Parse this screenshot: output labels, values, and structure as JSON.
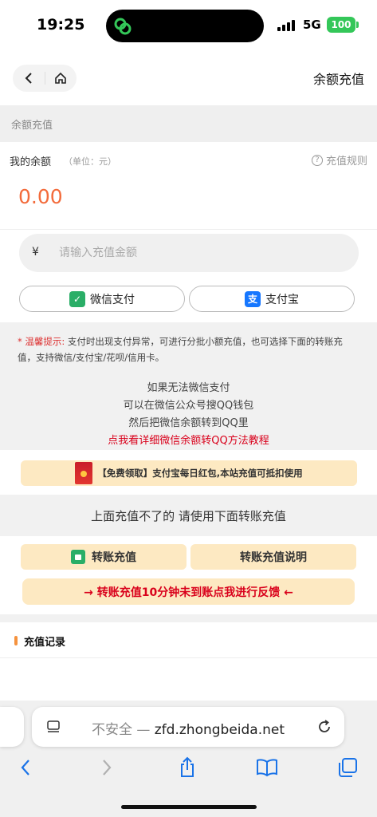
{
  "status_bar": {
    "time": "19:25",
    "network": "5G",
    "battery": "100"
  },
  "header": {
    "title": "余额充值"
  },
  "section": {
    "title": "余额充值"
  },
  "balance": {
    "label": "我的余额",
    "unit": "（单位：元）",
    "rules_label": "充值规则",
    "value": "0.00",
    "value_color": "#f36b3b"
  },
  "form": {
    "currency_symbol": "¥",
    "amount_placeholder": "请输入充值金额",
    "wechat_label": "微信支付",
    "alipay_label": "支付宝",
    "wechat_icon": "wechat-pay-icon",
    "alipay_icon": "alipay-icon"
  },
  "notice": {
    "tip_label": "* 温馨提示:",
    "tip_text": " 支付时出现支付异常，可进行分批小额充值，也可选择下面的转账充值，支持微信/支付宝/花呗/信用卡。",
    "line1": "如果无法微信支付",
    "line2": "可以在微信公众号搜QQ钱包",
    "line3": "然后把微信余额转到QQ里",
    "tutorial_link": "点我看详细微信余额转QQ方法教程"
  },
  "free_banner": {
    "text": "【免费领取】支付宝每日红包,本站充值可抵扣使用"
  },
  "transfer": {
    "notice": "上面充值不了的 请使用下面转账充值",
    "transfer_label": "转账充值",
    "instructions_label": "转账充值说明",
    "feedback_label": "→ 转账充值10分钟未到账点我进行反馈 ←"
  },
  "records": {
    "title": "充值记录"
  },
  "browser": {
    "insecure_label": "不安全 —",
    "domain": "zfd.zhongbeida.net"
  },
  "colors": {
    "accent_orange": "#f36b3b",
    "banner_bg": "#fde9c2",
    "alert_red": "#d9001b",
    "wechat_green": "#2aae67",
    "alipay_blue": "#1677ff"
  }
}
